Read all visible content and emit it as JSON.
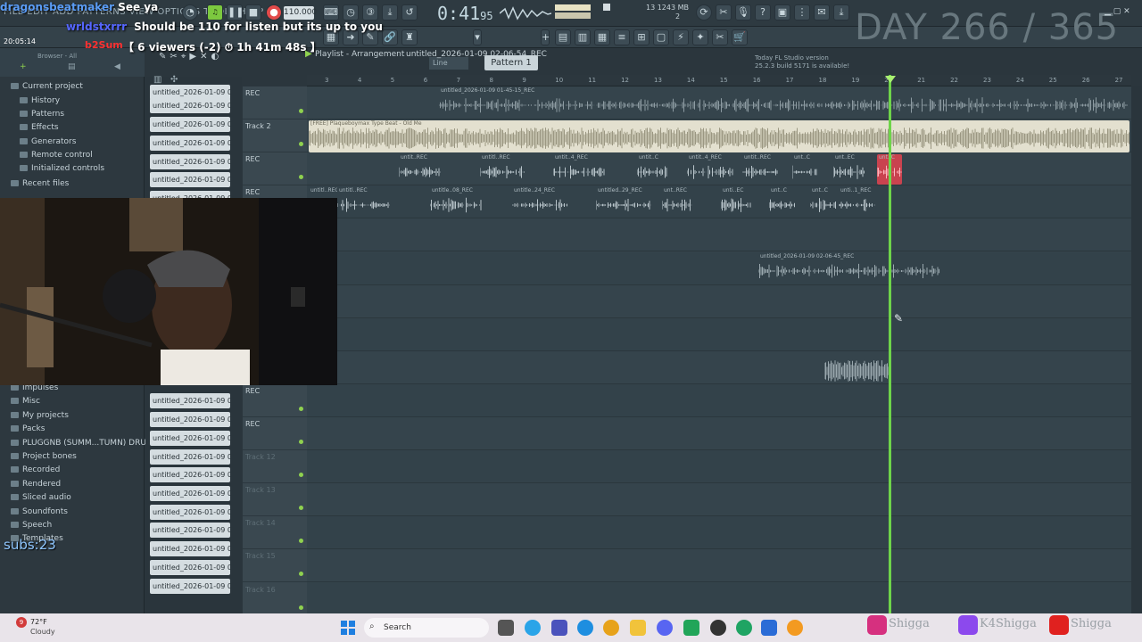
{
  "toolbar": {
    "menu_text": "FILE EDIT ADD PATTERNS VIEW OPTIONS TOOLS HELP",
    "tempo": "110.000",
    "time_main": "0:41",
    "time_frac": "95",
    "memory": "1243 MB",
    "cpu": "13",
    "cpu_voices": "2",
    "snap": "Line",
    "pattern": "Pattern 1",
    "news_line1": "Today  FL Studio version",
    "news_line2": "25.2.3 build 5171 is available!"
  },
  "stream": {
    "clock": "20:05:14",
    "chat1_user": "dragonsbeatmaker",
    "chat1_msg": "See ya",
    "chat2_user": "wrldstxrrr",
    "chat2_msg": "Should be 110 for listen but its up to you",
    "chat3_user": "b2Sum",
    "viewers": "【 6 viewers (-2) ⏱ 1h 41m 48s 】",
    "day_counter": "DAY 266 / 365",
    "subs": "subs:23"
  },
  "browser": {
    "search_label": "Browser - All",
    "items": [
      {
        "label": "Current project",
        "sub": false
      },
      {
        "label": "History",
        "sub": true
      },
      {
        "label": "Patterns",
        "sub": true
      },
      {
        "label": "Effects",
        "sub": true
      },
      {
        "label": "Generators",
        "sub": true
      },
      {
        "label": "Remote control",
        "sub": true
      },
      {
        "label": "Initialized controls",
        "sub": true
      },
      {
        "label": "Recent files",
        "sub": false
      }
    ],
    "items_lower": [
      {
        "label": "Impulses"
      },
      {
        "label": "Misc"
      },
      {
        "label": "My projects"
      },
      {
        "label": "Packs"
      },
      {
        "label": "PLUGGNB (SUMM...TUMN) DRUMKIT"
      },
      {
        "label": "Project bones"
      },
      {
        "label": "Recorded"
      },
      {
        "label": "Rendered"
      },
      {
        "label": "Sliced audio"
      },
      {
        "label": "Soundfonts"
      },
      {
        "label": "Speech"
      },
      {
        "label": "Templates"
      }
    ]
  },
  "playlist": {
    "title": "Playlist - Arrangement",
    "file": "untitled_2026-01-09 02-06-54_REC",
    "ruler": [
      "3",
      "4",
      "5",
      "6",
      "7",
      "8",
      "9",
      "10",
      "11",
      "12",
      "13",
      "14",
      "15",
      "16",
      "17",
      "18",
      "19",
      "20",
      "21",
      "22",
      "23",
      "24",
      "25",
      "26",
      "27"
    ],
    "tracks": [
      {
        "name": "REC"
      },
      {
        "name": "Track 2"
      },
      {
        "name": "REC"
      },
      {
        "name": "REC"
      },
      {
        "name": ""
      },
      {
        "name": ""
      },
      {
        "name": ""
      },
      {
        "name": ""
      },
      {
        "name": ""
      },
      {
        "name": "REC"
      },
      {
        "name": "REC"
      },
      {
        "name": "Track 12"
      },
      {
        "name": "Track 13"
      },
      {
        "name": "Track 14"
      },
      {
        "name": "Track 15"
      },
      {
        "name": "Track 16"
      }
    ],
    "clip_top": "untitled_2026-01-09 01-45-15_REC",
    "clip_beat": "[FREE] Plaqueboymax Type Beat - Old Me",
    "clip_row3": [
      "untit..REC",
      "untitl..REC",
      "untit..4_REC",
      "untit..C",
      "untit..4_REC",
      "untit..REC",
      "unt..C",
      "unt..EC",
      "unt..C"
    ],
    "clip_row4": [
      "untitl..REC",
      "untitl..REC",
      "untitle..08_REC",
      "untitle..24_REC",
      "untitled..29_REC",
      "unt..REC",
      "unti..EC",
      "unt..C",
      "unt..C",
      "unti..1_REC"
    ],
    "clip_row6": "untitled_2026-01-09 02-06-45_REC"
  },
  "patterns": {
    "items": [
      "untitled_2026-01-09 01-",
      "untitled_2026-01-09 01-",
      "untitled_2026-01-09 01-",
      "untitled_2026-01-09 01-",
      "untitled_2026-01-09 01-",
      "untitled_2026-01-09 01-",
      "untitled_2026-01-09 01-",
      "untitled_2026-01-09 01-",
      "untitled_2026-01-09 01-",
      "untitled_2026-01-09 01-",
      "untitled_2026-01-09 01-",
      "untitled_2026-01-09 01-",
      "untitled_2026-01-09 01-",
      "untitled_2026-01-09 01-",
      "untitled_2026-01-09 01-",
      "untitled_2026-01-09 01-",
      "untitled_2026-01-09 01-",
      "untitled_2026-01-09 01-"
    ]
  },
  "taskbar": {
    "weather_temp": "72°F",
    "weather_desc": "Cloudy",
    "search": "Search",
    "social_ig": "Shigga",
    "social_twitch": "K4Shigga",
    "social_yt": "Shigga"
  }
}
